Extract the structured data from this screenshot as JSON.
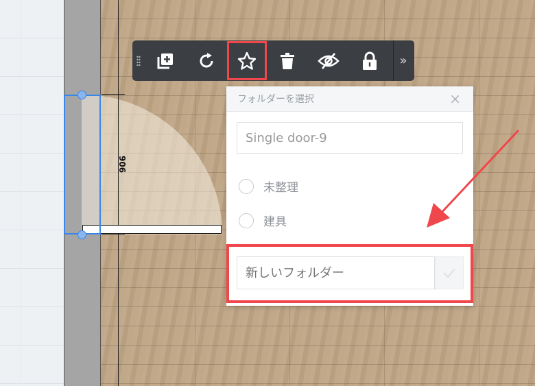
{
  "canvas": {
    "dimension_label": "906"
  },
  "toolbar": {
    "buttons": [
      {
        "name": "duplicate",
        "icon": "duplicate-icon"
      },
      {
        "name": "rotate",
        "icon": "rotate-icon"
      },
      {
        "name": "favorite",
        "icon": "star-icon",
        "active": true
      },
      {
        "name": "delete",
        "icon": "trash-icon"
      },
      {
        "name": "hide",
        "icon": "eye-off-icon"
      },
      {
        "name": "lock",
        "icon": "lock-icon"
      }
    ],
    "more_label": "»"
  },
  "folder_popup": {
    "title": "フォルダーを選択",
    "close_label": "×",
    "name_value": "Single door-9",
    "folders": [
      {
        "label": "未整理"
      },
      {
        "label": "建具"
      }
    ],
    "new_folder_placeholder": "新しいフォルダー"
  },
  "colors": {
    "highlight": "#f0474c",
    "selection": "#3a86e8",
    "toolbar_bg": "#3b3e43"
  }
}
